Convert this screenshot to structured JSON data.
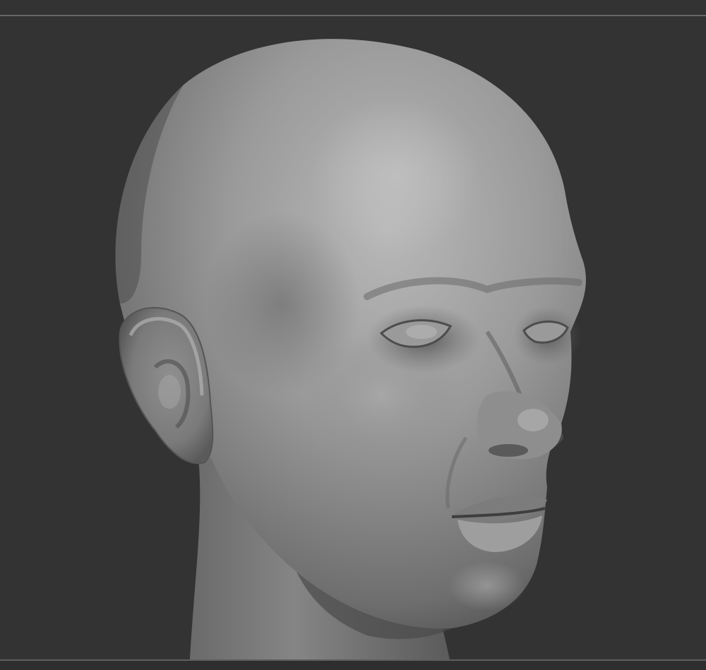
{
  "colors": {
    "background": "#333333",
    "divider": "#686868",
    "clay_light": "#b9b9b9",
    "clay_mid": "#8d8d8d",
    "clay_dark": "#4a4a4a"
  },
  "viewport": {
    "subject": "sculpted-head-model",
    "material": "matcap-gray-clay"
  }
}
